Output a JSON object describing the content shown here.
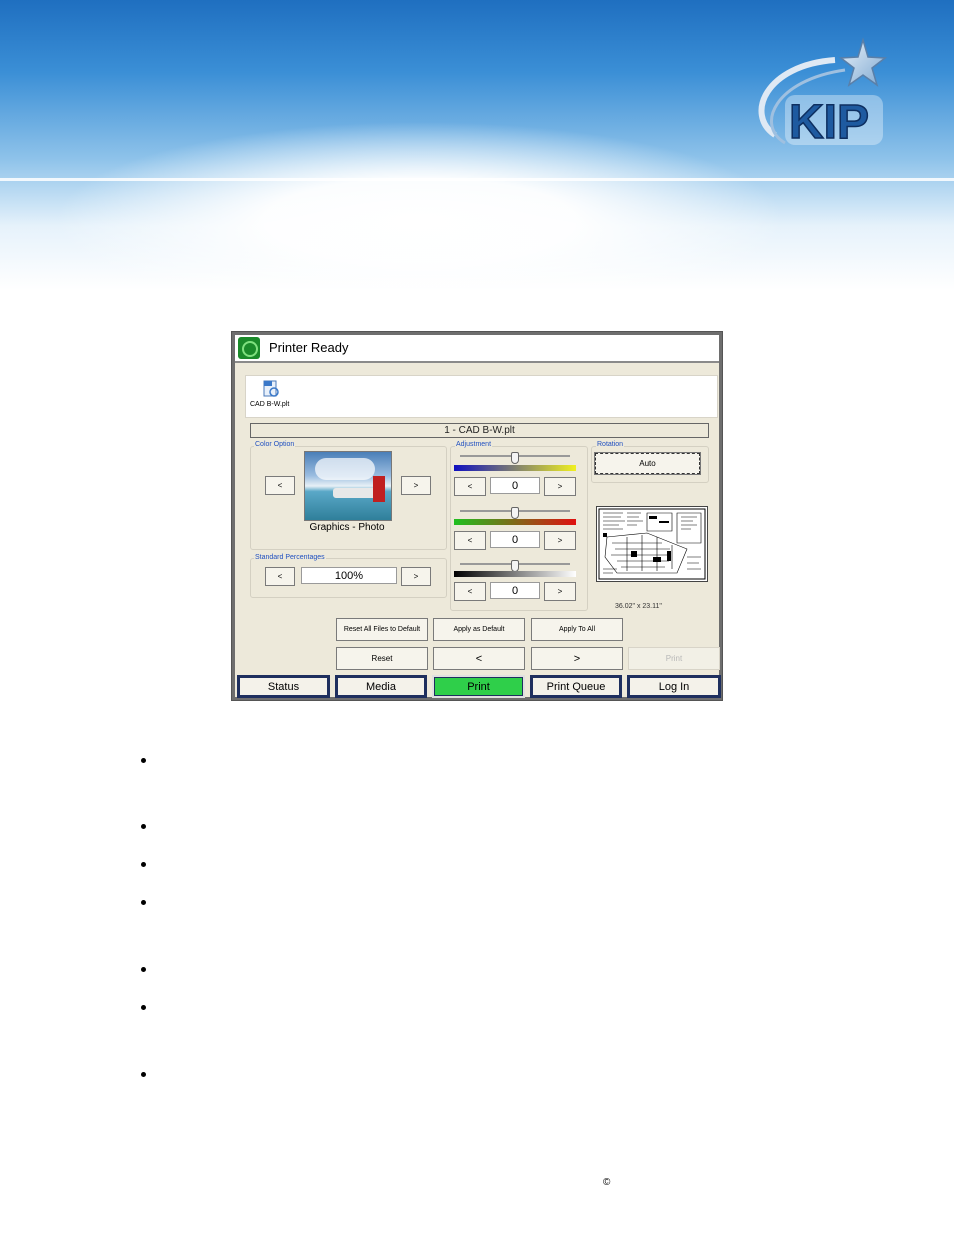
{
  "app": {
    "status_title": "Printer Ready",
    "file_name": "CAD B-W.plt",
    "document_title": "1 - CAD B-W.plt"
  },
  "color_option": {
    "label": "Color Option",
    "prev": "<",
    "next": ">",
    "mode": "Graphics - Photo"
  },
  "standard_percentages": {
    "label": "Standard Percentages",
    "prev": "<",
    "next": ">",
    "value": "100%"
  },
  "adjustment": {
    "label": "Adjustment",
    "sliders": [
      {
        "value": "0",
        "dec": "<",
        "inc": ">",
        "colors": [
          "#1010c0",
          "#f0f020"
        ]
      },
      {
        "value": "0",
        "dec": "<",
        "inc": ">",
        "colors": [
          "#20c020",
          "#e01010"
        ]
      },
      {
        "value": "0",
        "dec": "<",
        "inc": ">",
        "colors": [
          "#000000",
          "#ffffff"
        ]
      }
    ]
  },
  "rotation": {
    "label": "Rotation",
    "value": "Auto"
  },
  "preview": {
    "dimensions": "36.02\" x 23.11\""
  },
  "actions": {
    "reset_all": "Reset All Files to Default",
    "apply_default": "Apply as Default",
    "apply_all": "Apply To All",
    "reset": "Reset",
    "prev": "<",
    "next": ">",
    "print_disabled": "Print"
  },
  "nav": [
    {
      "label": "Status",
      "active": false
    },
    {
      "label": "Media",
      "active": false
    },
    {
      "label": "Print",
      "active": true
    },
    {
      "label": "Print Queue",
      "active": false
    },
    {
      "label": "Log In",
      "active": false
    }
  ],
  "footer": {
    "copyright": "©"
  },
  "brand": {
    "logo_text": "KIP"
  }
}
